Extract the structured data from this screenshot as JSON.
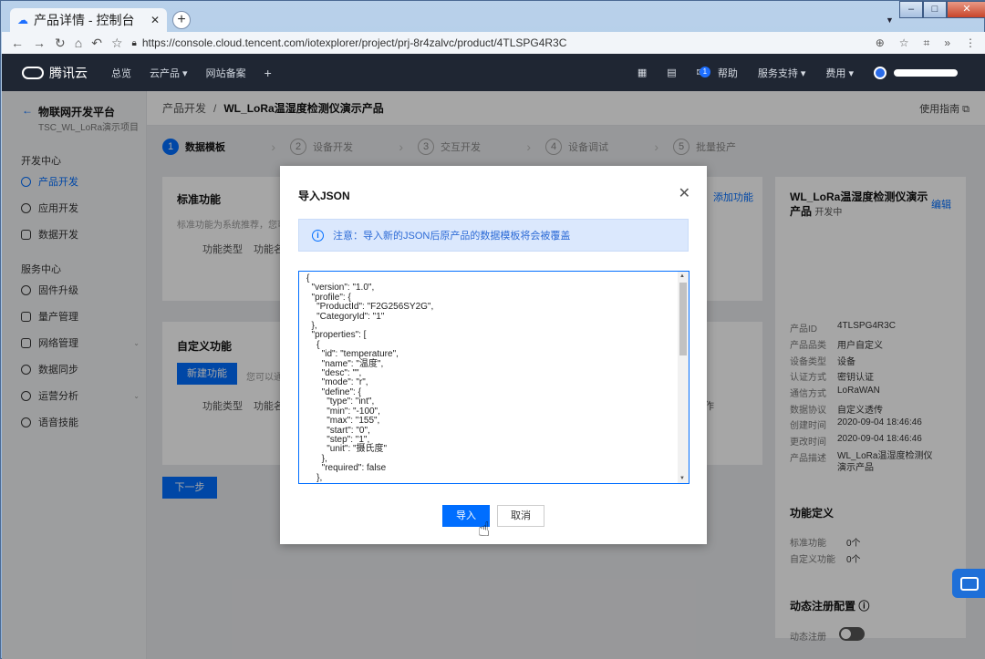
{
  "browser": {
    "tab_title": "产品详情 - 控制台",
    "url": "https://console.cloud.tencent.com/iotexplorer/project/prj-8r4zalvc/product/4TLSPG4R3C"
  },
  "topnav": {
    "brand": "腾讯云",
    "items": [
      "总览",
      "云产品 ▾",
      "网站备案",
      "+"
    ],
    "help": "帮助",
    "support": "服务支持 ▾",
    "billing": "费用 ▾",
    "badge_count": "1"
  },
  "sidebar": {
    "back_label": "物联网开发平台",
    "project": "TSC_WL_LoRa演示项目",
    "group1": "开发中心",
    "dev_items": [
      "产品开发",
      "应用开发",
      "数据开发"
    ],
    "group2": "服务中心",
    "svc_items": [
      "固件升级",
      "量产管理",
      "网络管理",
      "数据同步",
      "运营分析",
      "语音技能"
    ]
  },
  "breadcrumb": {
    "root": "产品开发",
    "sep": "/",
    "current": "WL_LoRa温湿度检测仪演示产品",
    "guide": "使用指南 ⧉"
  },
  "steps": [
    {
      "num": "1",
      "label": "数据模板"
    },
    {
      "num": "2",
      "label": "设备开发"
    },
    {
      "num": "3",
      "label": "交互开发"
    },
    {
      "num": "4",
      "label": "设备调试"
    },
    {
      "num": "5",
      "label": "批量投产"
    }
  ],
  "standard": {
    "title": "标准功能",
    "desc": "标准功能为系统推荐，您可",
    "col1": "功能类型",
    "col2": "功能名",
    "add": "添加功能"
  },
  "custom": {
    "title": "自定义功能",
    "new_btn": "新建功能",
    "desc": "您可以通",
    "col1": "功能类型",
    "col2": "功能名",
    "col_op": "作"
  },
  "next_btn": "下一步",
  "info": {
    "title": "WL_LoRa温湿度检测仪演示产品",
    "status": "开发中",
    "edit": "编辑",
    "rows": [
      {
        "k": "产品ID",
        "v": "4TLSPG4R3C"
      },
      {
        "k": "产品品类",
        "v": "用户自定义"
      },
      {
        "k": "设备类型",
        "v": "设备"
      },
      {
        "k": "认证方式",
        "v": "密钥认证"
      },
      {
        "k": "通信方式",
        "v": "LoRaWAN"
      },
      {
        "k": "数据协议",
        "v": "自定义透传"
      },
      {
        "k": "创建时间",
        "v": "2020-09-04 18:46:46"
      },
      {
        "k": "更改时间",
        "v": "2020-09-04 18:46:46"
      },
      {
        "k": "产品描述",
        "v": "WL_LoRa温湿度检测仪演示产品"
      }
    ],
    "func_title": "功能定义",
    "std_label": "标准功能",
    "std_val": "0个",
    "cus_label": "自定义功能",
    "cus_val": "0个",
    "dyn_title": "动态注册配置 ⓘ",
    "dyn_label": "动态注册"
  },
  "modal": {
    "title": "导入JSON",
    "close": "✕",
    "notice": "注意：导入新的JSON后原产品的数据模板将会被覆盖",
    "code": "{\n  \"version\": \"1.0\",\n  \"profile\": {\n    \"ProductId\": \"F2G256SY2G\",\n    \"CategoryId\": \"1\"\n  },\n  \"properties\": [\n    {\n      \"id\": \"temperature\",\n      \"name\": \"温度\",\n      \"desc\": \"\",\n      \"mode\": \"r\",\n      \"define\": {\n        \"type\": \"int\",\n        \"min\": \"-100\",\n        \"max\": \"155\",\n        \"start\": \"0\",\n        \"step\": \"1\",\n        \"unit\": \"摄氏度\"\n      },\n      \"required\": false\n    },",
    "ok": "导入",
    "cancel": "取消"
  }
}
